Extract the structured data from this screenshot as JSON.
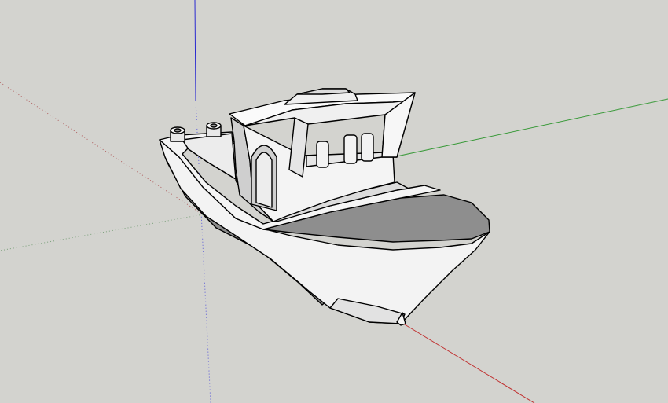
{
  "viewport": {
    "background": "#d3d3cf",
    "model": "3d-benchy-boat"
  },
  "axes": {
    "red_color": "#c03030",
    "green_color": "#3a9a3a",
    "blue_color": "#2a2ad0"
  },
  "model_colors": {
    "light_face": "#f2f2f2",
    "mid_face": "#d8d8d8",
    "dark_face": "#8c8c8c",
    "edge": "#000000"
  }
}
